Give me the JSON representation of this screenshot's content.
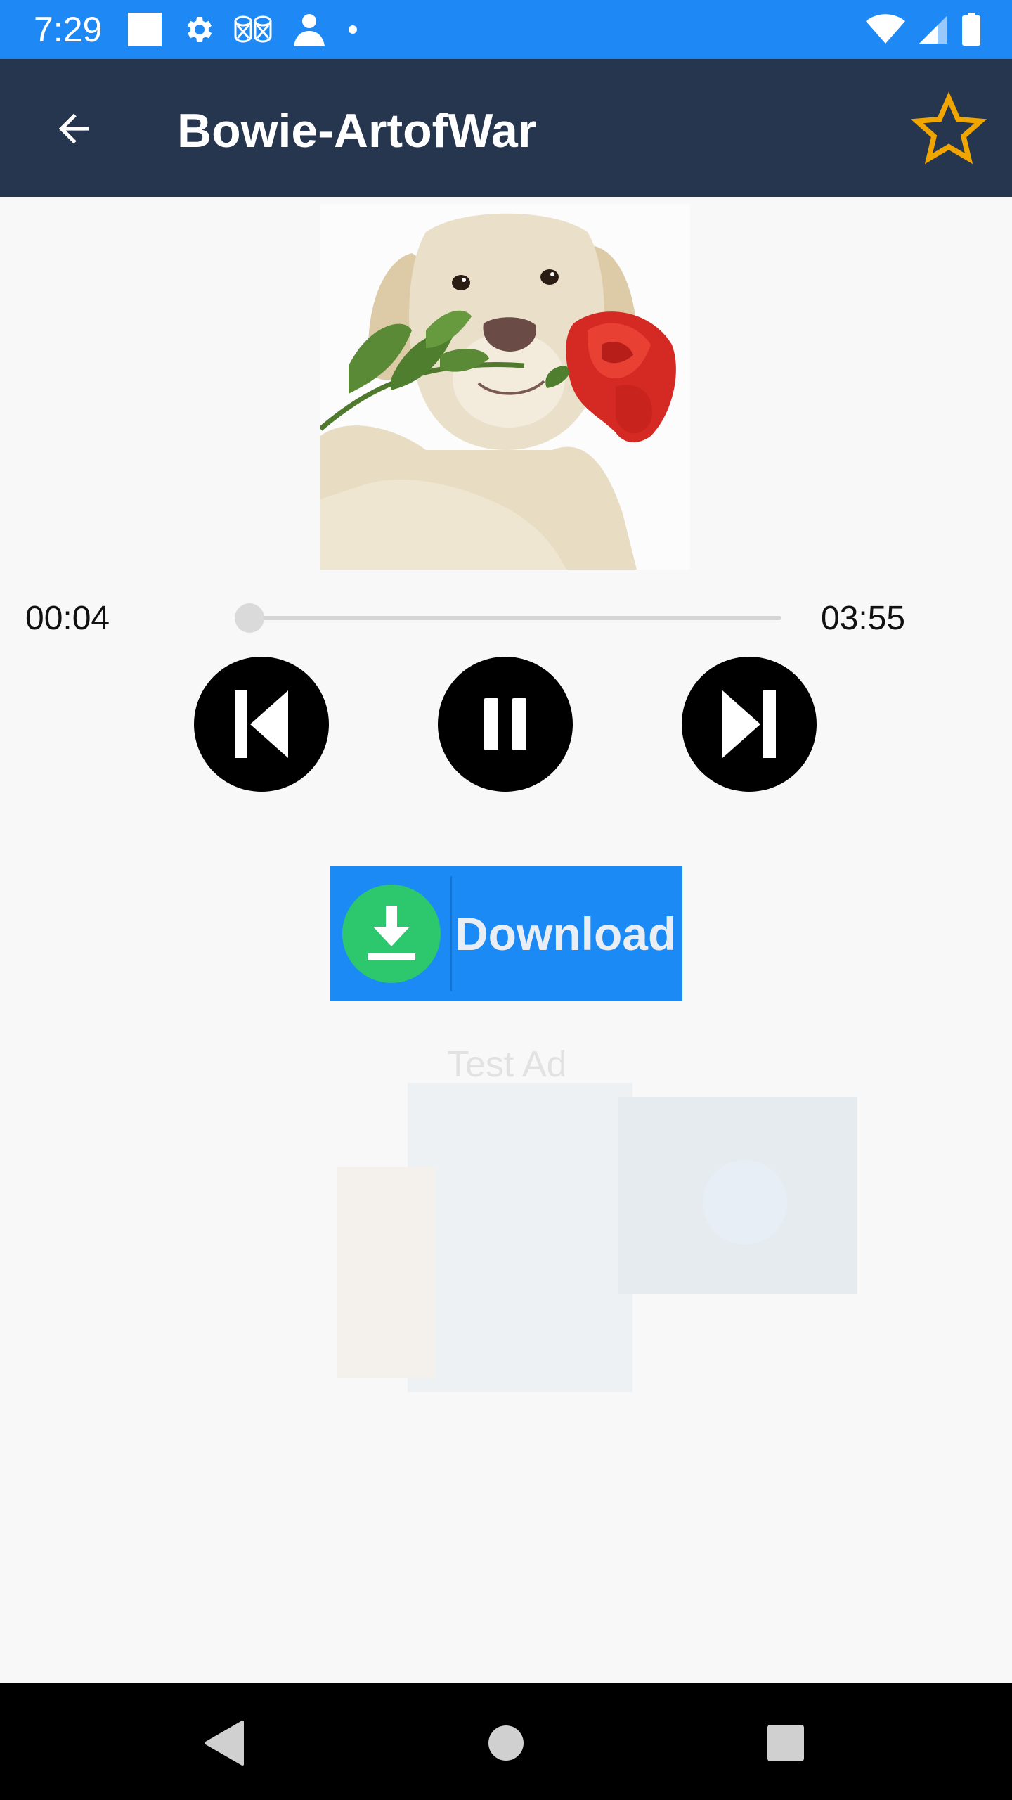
{
  "status_bar": {
    "time": "7:29",
    "left_icons": [
      "square-notification-icon",
      "settings-icon",
      "drums-icon",
      "person-icon",
      "dot-icon"
    ],
    "right_icons": [
      "wifi-icon",
      "cell-signal-icon",
      "battery-icon"
    ]
  },
  "app_bar": {
    "title": "Bowie-ArtofWar",
    "back_icon": "arrow-back-icon",
    "favorite_icon": "star-outline-icon",
    "favorite_color": "#f0a500"
  },
  "player": {
    "artwork": "puppy-with-rose-image",
    "elapsed": "00:04",
    "duration": "03:55",
    "progress": 0.017,
    "controls": {
      "previous_icon": "skip-previous-icon",
      "pause_icon": "pause-icon",
      "next_icon": "skip-next-icon"
    }
  },
  "download": {
    "label": "Download",
    "icon": "download-arrow-icon",
    "button_color": "#1b8af5",
    "icon_circle_color": "#2dc76d"
  },
  "ad": {
    "label": "Test Ad"
  },
  "nav_bar": {
    "icons": [
      "nav-back-icon",
      "nav-home-icon",
      "nav-recents-icon"
    ]
  },
  "colors": {
    "status_bar": "#1e88f5",
    "app_bar": "#25364e",
    "background": "#f8f8f8"
  }
}
